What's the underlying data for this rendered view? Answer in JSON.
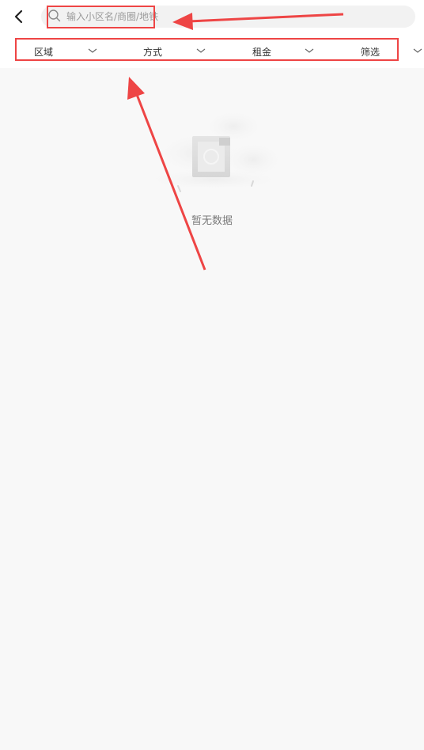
{
  "search": {
    "placeholder": "输入小区名/商圈/地铁"
  },
  "filters": [
    {
      "label": "区域"
    },
    {
      "label": "方式"
    },
    {
      "label": "租金"
    },
    {
      "label": "筛选"
    }
  ],
  "empty_state": {
    "text": "暂无数据"
  },
  "icons": {
    "back": "back-arrow-icon",
    "search": "search-icon",
    "dropdown": "chevron-down-icon"
  },
  "colors": {
    "annotation": "#ee4545",
    "background": "#f8f8f8",
    "header": "#ffffff"
  }
}
